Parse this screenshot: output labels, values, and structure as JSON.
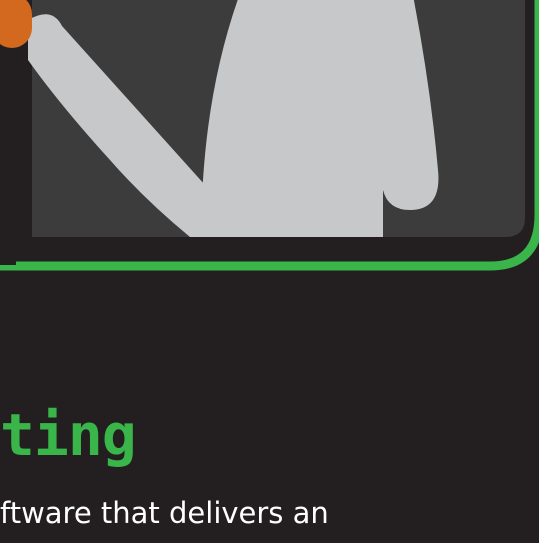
{
  "colors": {
    "background": "#231f20",
    "panel": "#3c3c3c",
    "accent": "#3ab54a",
    "figure": "#c7c8ca",
    "marker": "#d2691e",
    "text": "#ffffff"
  },
  "illustration": {
    "icon": "person-at-board-icon"
  },
  "heading": {
    "text": "ting"
  },
  "description": {
    "text": "ftware that delivers an"
  }
}
